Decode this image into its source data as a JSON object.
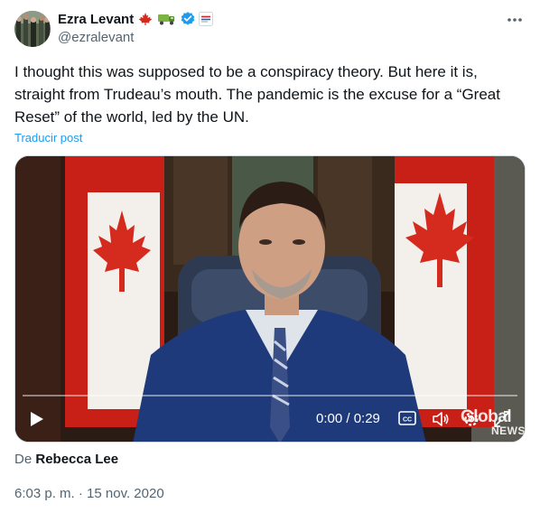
{
  "author": {
    "name": "Ezra Levant",
    "handle": "@ezralevant",
    "badges": [
      "canada-flag-icon",
      "truck-icon",
      "verified-badge-icon",
      "affiliate-badge-icon"
    ]
  },
  "tweet": {
    "text": "I thought this was supposed to be a conspiracy theory. But here it is, straight from Trudeau’s mouth. The pandemic is the excuse for a “Great Reset” of the world, led by the UN.",
    "translate_label": "Traducir post"
  },
  "video": {
    "time": "0:00 / 0:29",
    "watermark_line1": "Global",
    "watermark_line2": "NEWS",
    "progress": 0
  },
  "source": {
    "prefix": "De",
    "name": "Rebecca Lee"
  },
  "timestamp": "6:03 p. m. · 15 nov. 2020",
  "colors": {
    "link": "#1d9bf0",
    "verified": "#1d9bf0",
    "secondary_text": "#536471",
    "flag_red": "#d52b1e"
  }
}
